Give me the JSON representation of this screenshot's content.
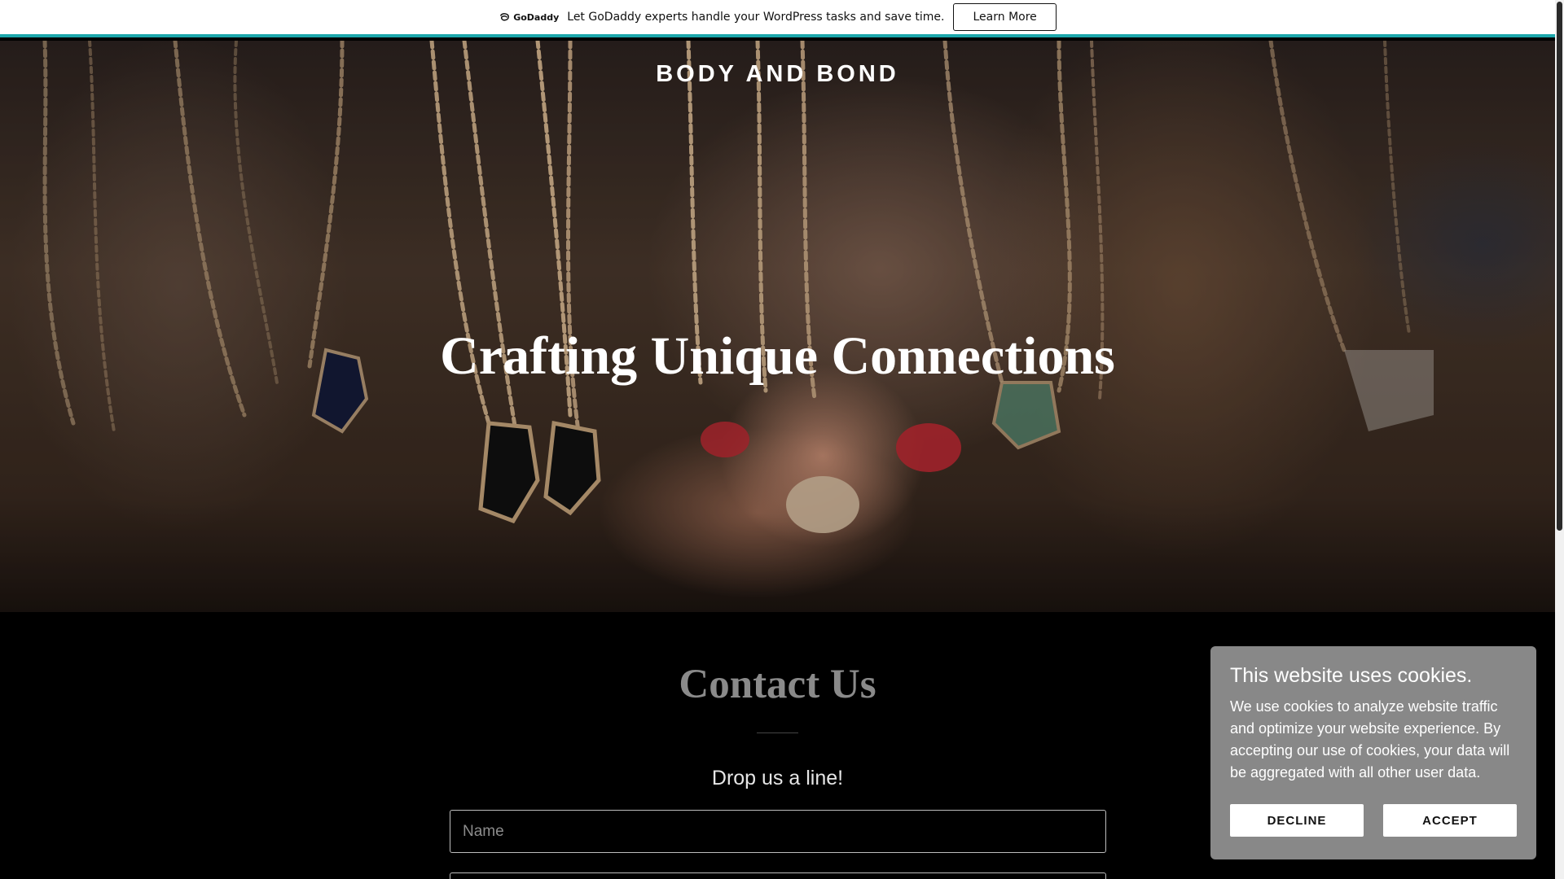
{
  "promo": {
    "logo_text": "GoDaddy",
    "message": "Let GoDaddy experts handle your WordPress tasks and save time.",
    "cta_label": "Learn More",
    "accent_color": "#1ba6ab"
  },
  "hero": {
    "site_title": "BODY AND BOND",
    "heading": "Crafting Unique Connections"
  },
  "contact": {
    "title": "Contact Us",
    "subtitle": "Drop us a line!",
    "name_placeholder": "Name",
    "email_placeholder": ""
  },
  "cookie_banner": {
    "title": "This website uses cookies.",
    "text": "We use cookies to analyze website traffic and optimize your website experience. By accepting our use of cookies, your data will be aggregated with all other user data.",
    "decline_label": "DECLINE",
    "accept_label": "ACCEPT",
    "background_color": "#888888"
  }
}
